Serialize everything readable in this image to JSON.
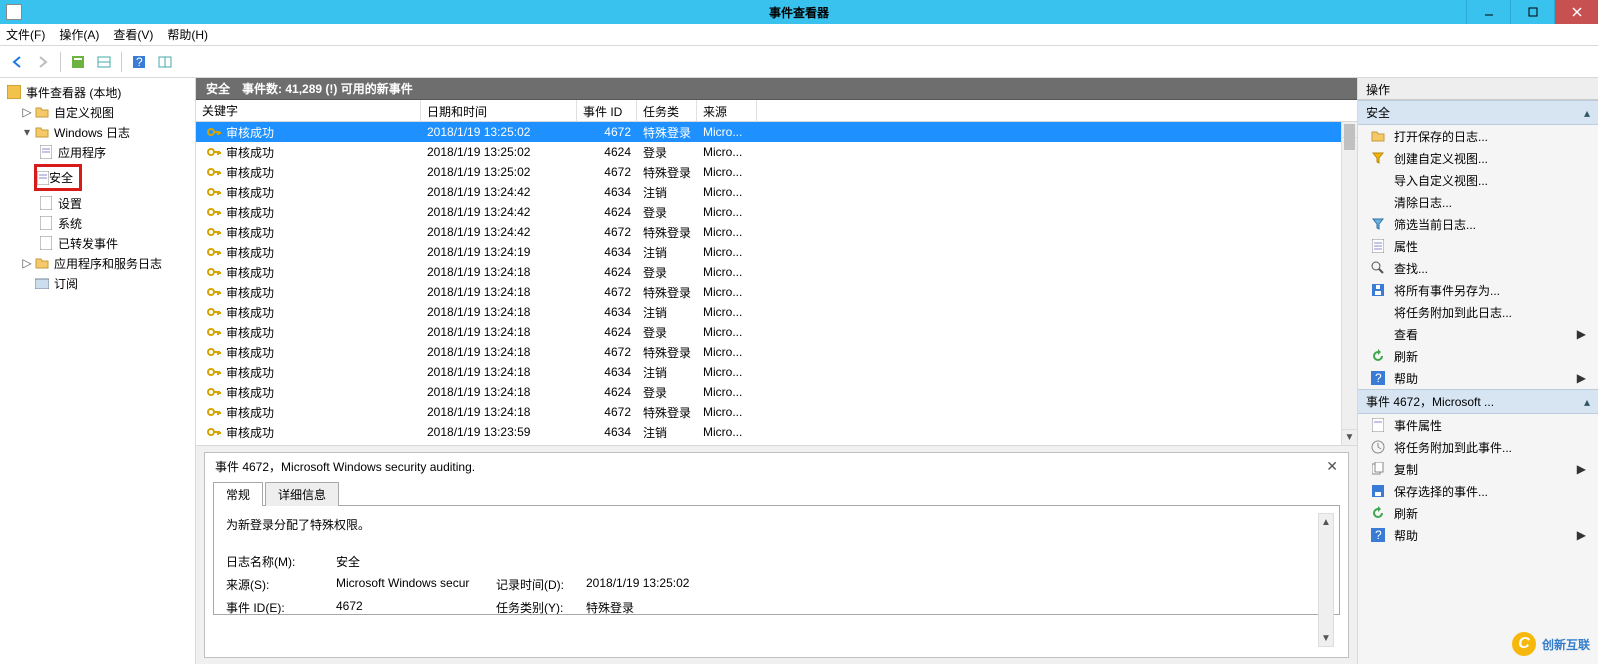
{
  "titlebar": {
    "title": "事件查看器"
  },
  "menubar": {
    "file": "文件(F)",
    "action": "操作(A)",
    "view": "查看(V)",
    "help": "帮助(H)"
  },
  "tree": {
    "root": "事件查看器 (本地)",
    "customViews": "自定义视图",
    "windowsLogs": "Windows 日志",
    "appEvents": "应用程序",
    "security": "安全",
    "setup": "设置",
    "system": "系统",
    "forwarded": "已转发事件",
    "appServiceLogs": "应用程序和服务日志",
    "subscriptions": "订阅"
  },
  "center": {
    "headerLabel": "安全",
    "headerCount": "事件数: 41,289 (!) 可用的新事件",
    "columns": {
      "key": "关键字",
      "date": "日期和时间",
      "id": "事件 ID",
      "task": "任务类别",
      "source": "来源"
    },
    "rows": [
      {
        "key": "审核成功",
        "date": "2018/1/19 13:25:02",
        "id": "4672",
        "task": "特殊登录",
        "source": "Micro..."
      },
      {
        "key": "审核成功",
        "date": "2018/1/19 13:25:02",
        "id": "4624",
        "task": "登录",
        "source": "Micro..."
      },
      {
        "key": "审核成功",
        "date": "2018/1/19 13:25:02",
        "id": "4672",
        "task": "特殊登录",
        "source": "Micro..."
      },
      {
        "key": "审核成功",
        "date": "2018/1/19 13:24:42",
        "id": "4634",
        "task": "注销",
        "source": "Micro..."
      },
      {
        "key": "审核成功",
        "date": "2018/1/19 13:24:42",
        "id": "4624",
        "task": "登录",
        "source": "Micro..."
      },
      {
        "key": "审核成功",
        "date": "2018/1/19 13:24:42",
        "id": "4672",
        "task": "特殊登录",
        "source": "Micro..."
      },
      {
        "key": "审核成功",
        "date": "2018/1/19 13:24:19",
        "id": "4634",
        "task": "注销",
        "source": "Micro..."
      },
      {
        "key": "审核成功",
        "date": "2018/1/19 13:24:18",
        "id": "4624",
        "task": "登录",
        "source": "Micro..."
      },
      {
        "key": "审核成功",
        "date": "2018/1/19 13:24:18",
        "id": "4672",
        "task": "特殊登录",
        "source": "Micro..."
      },
      {
        "key": "审核成功",
        "date": "2018/1/19 13:24:18",
        "id": "4634",
        "task": "注销",
        "source": "Micro..."
      },
      {
        "key": "审核成功",
        "date": "2018/1/19 13:24:18",
        "id": "4624",
        "task": "登录",
        "source": "Micro..."
      },
      {
        "key": "审核成功",
        "date": "2018/1/19 13:24:18",
        "id": "4672",
        "task": "特殊登录",
        "source": "Micro..."
      },
      {
        "key": "审核成功",
        "date": "2018/1/19 13:24:18",
        "id": "4634",
        "task": "注销",
        "source": "Micro..."
      },
      {
        "key": "审核成功",
        "date": "2018/1/19 13:24:18",
        "id": "4624",
        "task": "登录",
        "source": "Micro..."
      },
      {
        "key": "审核成功",
        "date": "2018/1/19 13:24:18",
        "id": "4672",
        "task": "特殊登录",
        "source": "Micro..."
      },
      {
        "key": "审核成功",
        "date": "2018/1/19 13:23:59",
        "id": "4634",
        "task": "注销",
        "source": "Micro..."
      }
    ],
    "detail": {
      "title": "事件 4672，Microsoft Windows security auditing.",
      "tabGeneral": "常规",
      "tabDetails": "详细信息",
      "message": "为新登录分配了特殊权限。",
      "logNameLabel": "日志名称(M):",
      "logName": "安全",
      "sourceLabel": "来源(S):",
      "source": "Microsoft Windows secur",
      "recordTimeLabel": "记录时间(D):",
      "recordTime": "2018/1/19 13:25:02",
      "eventIdLabel": "事件 ID(E):",
      "eventId": "4672",
      "taskCatLabel": "任务类别(Y):",
      "taskCat": "特殊登录"
    }
  },
  "actions": {
    "header": "操作",
    "section1": "安全",
    "openSaved": "打开保存的日志...",
    "createCustom": "创建自定义视图...",
    "importCustom": "导入自定义视图...",
    "clearLog": "清除日志...",
    "filterCurrent": "筛选当前日志...",
    "properties": "属性",
    "find": "查找...",
    "saveAllAs": "将所有事件另存为...",
    "attachTask": "将任务附加到此日志...",
    "view": "查看",
    "refresh": "刷新",
    "help": "帮助",
    "section2": "事件 4672，Microsoft ...",
    "eventProps": "事件属性",
    "attachTaskEvent": "将任务附加到此事件...",
    "copy": "复制",
    "saveSelected": "保存选择的事件...",
    "refresh2": "刷新",
    "help2": "帮助"
  },
  "watermark": {
    "text": "创新互联"
  }
}
